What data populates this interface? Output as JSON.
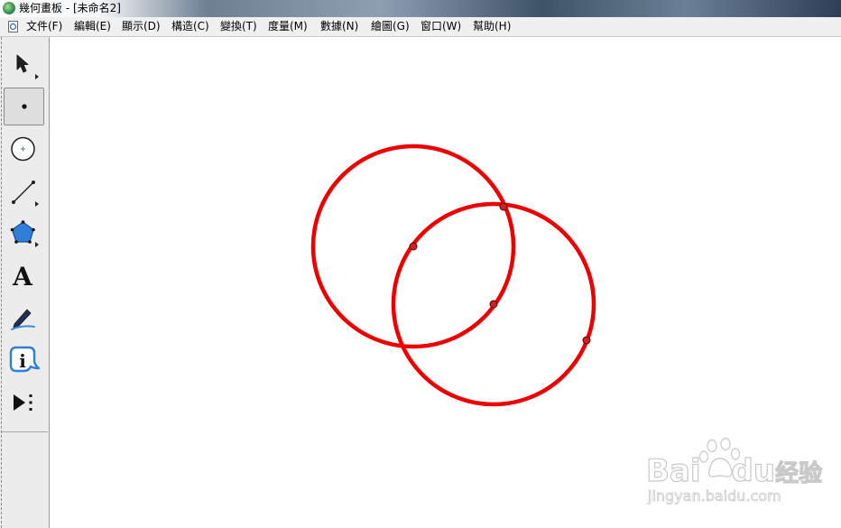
{
  "window": {
    "title": "幾何畫板 - [未命名2]"
  },
  "menu": {
    "items": [
      {
        "label": "文件(F)"
      },
      {
        "label": "編輯(E)"
      },
      {
        "label": "顯示(D)"
      },
      {
        "label": "構造(C)"
      },
      {
        "label": "變換(T)"
      },
      {
        "label": "度量(M)"
      },
      {
        "label": "數據(N)"
      },
      {
        "label": "繪圖(G)"
      },
      {
        "label": "窗口(W)"
      },
      {
        "label": "幫助(H)"
      }
    ]
  },
  "toolbar": {
    "tools": [
      {
        "name": "arrow-tool",
        "icon": "arrow-pointer-icon"
      },
      {
        "name": "point-tool",
        "icon": "point-icon",
        "selected": true
      },
      {
        "name": "compass-tool",
        "icon": "circle-compass-icon"
      },
      {
        "name": "straightedge-tool",
        "icon": "line-segment-icon"
      },
      {
        "name": "polygon-tool",
        "icon": "pentagon-icon"
      },
      {
        "name": "text-tool",
        "icon": "text-a-icon",
        "glyph": "A"
      },
      {
        "name": "marker-tool",
        "icon": "pen-marker-icon"
      },
      {
        "name": "information-tool",
        "icon": "info-bubble-icon",
        "glyph": "i"
      },
      {
        "name": "custom-tools",
        "icon": "play-more-icon"
      }
    ]
  },
  "canvas": {
    "stroke_color": "#ee0000",
    "point_fill": "#cc2222",
    "background": "#ffffff"
  },
  "watermark": {
    "brand_text": "Bai",
    "brand_text_2": "du",
    "product": "经验",
    "url": "jingyan.baidu.com"
  }
}
